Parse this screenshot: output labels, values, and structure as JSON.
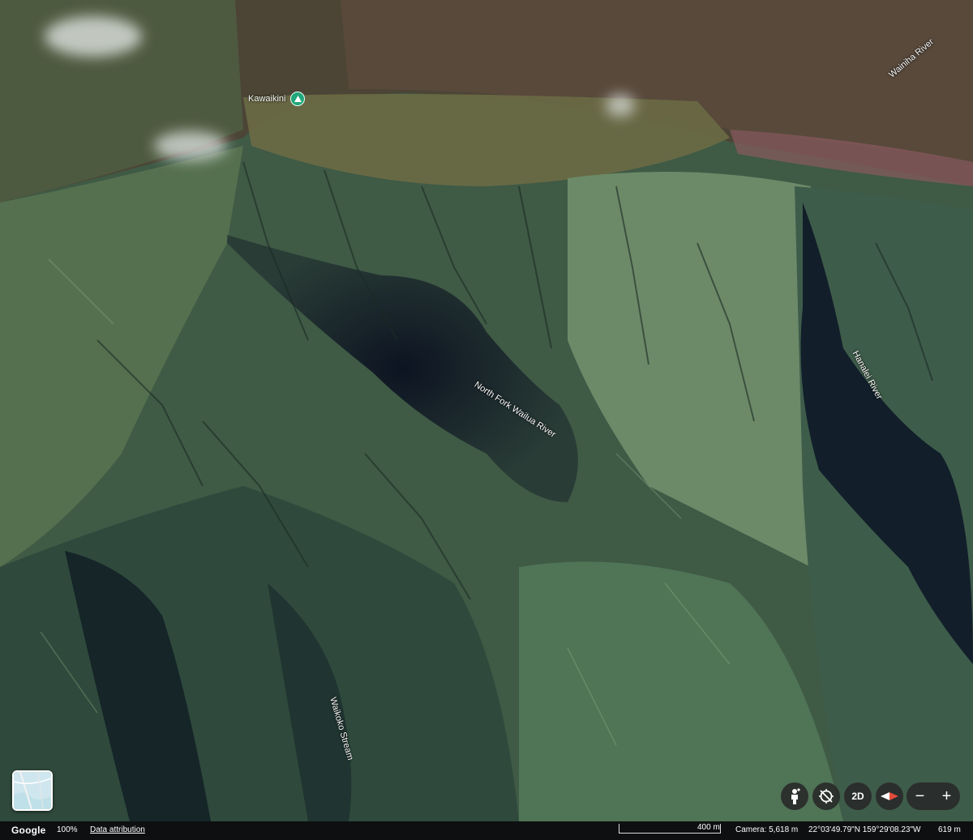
{
  "map": {
    "poi": {
      "name": "Kawaikini",
      "icon": "mountain-peak-icon"
    },
    "labels": {
      "wainiha_river": "Wainiha River",
      "north_fork_wailua_river": "North Fork Wailua River",
      "hanalei_river": "Hanalei River",
      "waikoko_stream": "Waikoko Stream"
    }
  },
  "layers": {
    "icon": "map-layers-icon"
  },
  "controls": {
    "pegman_icon": "street-view-person-icon",
    "compass_reset_icon": "tilt-reset-icon",
    "view_mode_label": "2D",
    "compass_icon": "compass-icon",
    "zoom_out_label": "−",
    "zoom_in_label": "+"
  },
  "status_bar": {
    "logo": "Google",
    "zoom": "100%",
    "data_attribution": "Data attribution",
    "scale_label": "400 m",
    "camera": "Camera: 5,618 m",
    "coordinates": "22°03'49.79\"N 159°29'08.23\"W",
    "elevation": "619 m"
  },
  "colors": {
    "poi_green": "#20a67a",
    "control_bg": "#282828",
    "status_bg": "#0e0f10"
  }
}
